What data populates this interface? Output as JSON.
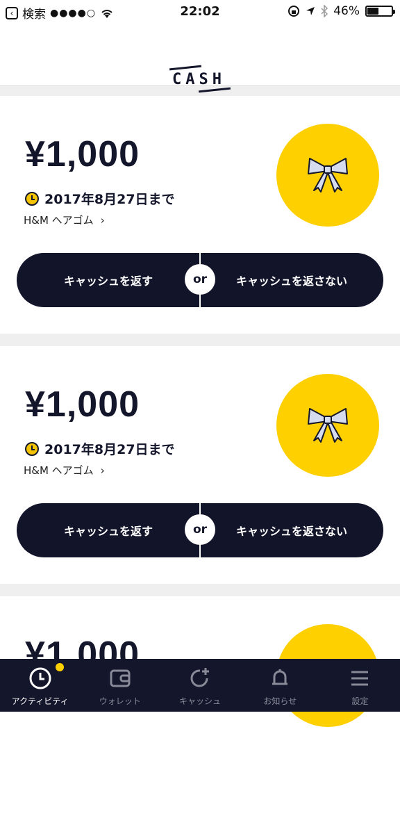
{
  "status": {
    "carrier": "検索",
    "signal": "●●●●○",
    "time": "22:02",
    "battery": "46%",
    "battery_level": 0.46
  },
  "header": {
    "logo": "CASH"
  },
  "cards": [
    {
      "amount": "¥1,000",
      "deadline": "2017年8月27日まで",
      "item": "H&M ヘアゴム",
      "return_label": "キャッシュを返す",
      "or_label": "or",
      "keep_label": "キャッシュを返さない"
    },
    {
      "amount": "¥1,000",
      "deadline": "2017年8月27日まで",
      "item": "H&M ヘアゴム",
      "return_label": "キャッシュを返す",
      "or_label": "or",
      "keep_label": "キャッシュを返さない"
    },
    {
      "amount": "¥1,000"
    }
  ],
  "tabs": [
    {
      "label": "アクティビティ",
      "icon": "clock-icon"
    },
    {
      "label": "ウォレット",
      "icon": "wallet-icon"
    },
    {
      "label": "キャッシュ",
      "icon": "cash-refresh-icon"
    },
    {
      "label": "お知らせ",
      "icon": "bell-icon"
    },
    {
      "label": "設定",
      "icon": "menu-icon"
    }
  ],
  "colors": {
    "accent": "#fed000",
    "dark": "#12142a"
  }
}
